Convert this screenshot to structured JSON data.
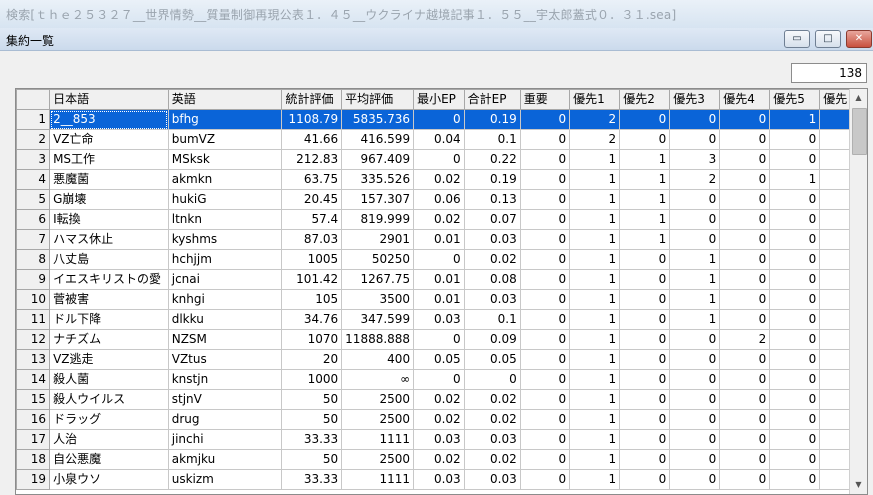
{
  "outer_title": "検索[ｔｈｅ２５３２７__世界情勢__質量制御再現公表１．４５__ウクライナ越境記事１．５５__宇太郎蓋式０．３１.sea]",
  "window": {
    "title": "集約一覧",
    "minimize_glyph": "▭",
    "maximize_glyph": "□",
    "close_glyph": "✕"
  },
  "count": "138",
  "table": {
    "columns": [
      "日本語",
      "英語",
      "統計評価",
      "平均評価",
      "最小EP",
      "合計EP",
      "重要",
      "優先1",
      "優先2",
      "優先3",
      "優先4",
      "優先5",
      "優先"
    ],
    "rows": [
      {
        "n": "1",
        "cells": [
          "2__853",
          "bfhg",
          "1108.79",
          "5835.736",
          "0",
          "0.19",
          "0",
          "2",
          "0",
          "0",
          "0",
          "1",
          ""
        ]
      },
      {
        "n": "2",
        "cells": [
          "VZ亡命",
          "bumVZ",
          "41.66",
          "416.599",
          "0.04",
          "0.1",
          "0",
          "2",
          "0",
          "0",
          "0",
          "0",
          ""
        ]
      },
      {
        "n": "3",
        "cells": [
          "MS工作",
          "MSksk",
          "212.83",
          "967.409",
          "0",
          "0.22",
          "0",
          "1",
          "1",
          "3",
          "0",
          "0",
          ""
        ]
      },
      {
        "n": "4",
        "cells": [
          "悪魔菌",
          "akmkn",
          "63.75",
          "335.526",
          "0.02",
          "0.19",
          "0",
          "1",
          "1",
          "2",
          "0",
          "1",
          ""
        ]
      },
      {
        "n": "5",
        "cells": [
          "G崩壊",
          "hukiG",
          "20.45",
          "157.307",
          "0.06",
          "0.13",
          "0",
          "1",
          "1",
          "0",
          "0",
          "0",
          ""
        ]
      },
      {
        "n": "6",
        "cells": [
          "I転換",
          "ltnkn",
          "57.4",
          "819.999",
          "0.02",
          "0.07",
          "0",
          "1",
          "1",
          "0",
          "0",
          "0",
          ""
        ]
      },
      {
        "n": "7",
        "cells": [
          "ハマス休止",
          "kyshms",
          "87.03",
          "2901",
          "0.01",
          "0.03",
          "0",
          "1",
          "1",
          "0",
          "0",
          "0",
          ""
        ]
      },
      {
        "n": "8",
        "cells": [
          "八丈島",
          "hchjjm",
          "1005",
          "50250",
          "0",
          "0.02",
          "0",
          "1",
          "0",
          "1",
          "0",
          "0",
          ""
        ]
      },
      {
        "n": "9",
        "cells": [
          "イエスキリストの愛",
          "jcnai",
          "101.42",
          "1267.75",
          "0.01",
          "0.08",
          "0",
          "1",
          "0",
          "1",
          "0",
          "0",
          ""
        ]
      },
      {
        "n": "10",
        "cells": [
          "菅被害",
          "knhgi",
          "105",
          "3500",
          "0.01",
          "0.03",
          "0",
          "1",
          "0",
          "1",
          "0",
          "0",
          ""
        ]
      },
      {
        "n": "11",
        "cells": [
          "ドル下降",
          "dlkku",
          "34.76",
          "347.599",
          "0.03",
          "0.1",
          "0",
          "1",
          "0",
          "1",
          "0",
          "0",
          ""
        ]
      },
      {
        "n": "12",
        "cells": [
          "ナチズム",
          "NZSM",
          "1070",
          "11888.888",
          "0",
          "0.09",
          "0",
          "1",
          "0",
          "0",
          "2",
          "0",
          ""
        ]
      },
      {
        "n": "13",
        "cells": [
          "VZ逃走",
          "VZtus",
          "20",
          "400",
          "0.05",
          "0.05",
          "0",
          "1",
          "0",
          "0",
          "0",
          "0",
          ""
        ]
      },
      {
        "n": "14",
        "cells": [
          "殺人菌",
          "knstjn",
          "1000",
          "∞",
          "0",
          "0",
          "0",
          "1",
          "0",
          "0",
          "0",
          "0",
          ""
        ]
      },
      {
        "n": "15",
        "cells": [
          "殺人ウイルス",
          "stjnV",
          "50",
          "2500",
          "0.02",
          "0.02",
          "0",
          "1",
          "0",
          "0",
          "0",
          "0",
          ""
        ]
      },
      {
        "n": "16",
        "cells": [
          "ドラッグ",
          "drug",
          "50",
          "2500",
          "0.02",
          "0.02",
          "0",
          "1",
          "0",
          "0",
          "0",
          "0",
          ""
        ]
      },
      {
        "n": "17",
        "cells": [
          "人治",
          "jinchi",
          "33.33",
          "1111",
          "0.03",
          "0.03",
          "0",
          "1",
          "0",
          "0",
          "0",
          "0",
          ""
        ]
      },
      {
        "n": "18",
        "cells": [
          "自公悪魔",
          "akmjku",
          "50",
          "2500",
          "0.02",
          "0.02",
          "0",
          "1",
          "0",
          "0",
          "0",
          "0",
          ""
        ]
      },
      {
        "n": "19",
        "cells": [
          "小泉ウソ",
          "uskizm",
          "33.33",
          "1111",
          "0.03",
          "0.03",
          "0",
          "1",
          "0",
          "0",
          "0",
          "0",
          ""
        ]
      }
    ]
  },
  "scrollbar": {
    "up_glyph": "▲",
    "down_glyph": "▼"
  }
}
